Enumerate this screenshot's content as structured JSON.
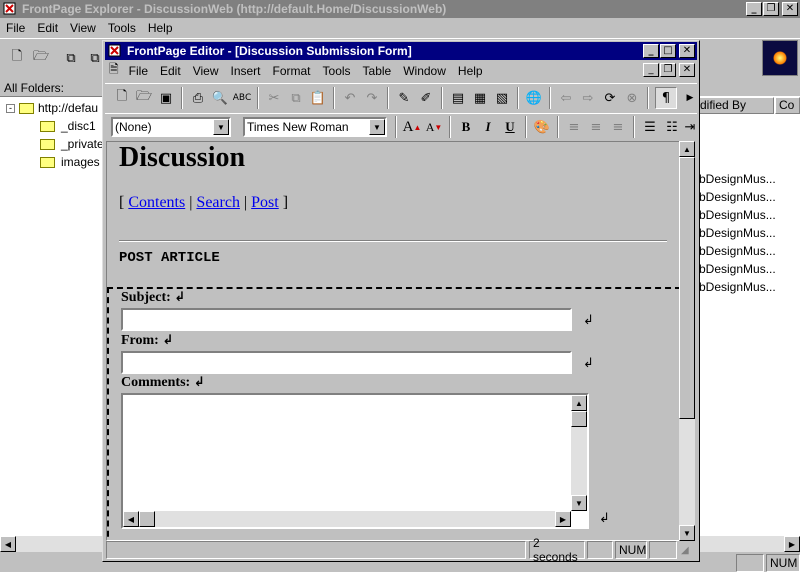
{
  "explorer": {
    "title": "FrontPage Explorer - DiscussionWeb (http://default.Home/DiscussionWeb)",
    "menu": [
      "File",
      "Edit",
      "View",
      "Tools",
      "Help"
    ],
    "folders_label": "All Folders:",
    "tree_root": "http://defau",
    "tree_items": [
      "_disc1",
      "_private",
      "images"
    ],
    "col_modified_by": "dified By",
    "col_co": "Co",
    "modified_by_values": [
      "bDesignMus...",
      "bDesignMus...",
      "bDesignMus...",
      "bDesignMus...",
      "bDesignMus...",
      "bDesignMus...",
      "bDesignMus..."
    ],
    "status_num": "NUM"
  },
  "editor": {
    "title": "FrontPage Editor - [Discussion Submission Form]",
    "menu": [
      "File",
      "Edit",
      "View",
      "Insert",
      "Format",
      "Tools",
      "Table",
      "Window",
      "Help"
    ],
    "style_value": "(None)",
    "font_value": "Times New Roman",
    "status_time": "2 seconds",
    "status_num": "NUM"
  },
  "page": {
    "heading": "Discussion",
    "nav_open": "[",
    "nav_links": [
      "Contents",
      "Search",
      "Post"
    ],
    "nav_sep": "|",
    "nav_close": "]",
    "section": "POST ARTICLE",
    "subject_label": "Subject:",
    "from_label": "From:",
    "comments_label": "Comments:",
    "para_mark": "↲"
  }
}
